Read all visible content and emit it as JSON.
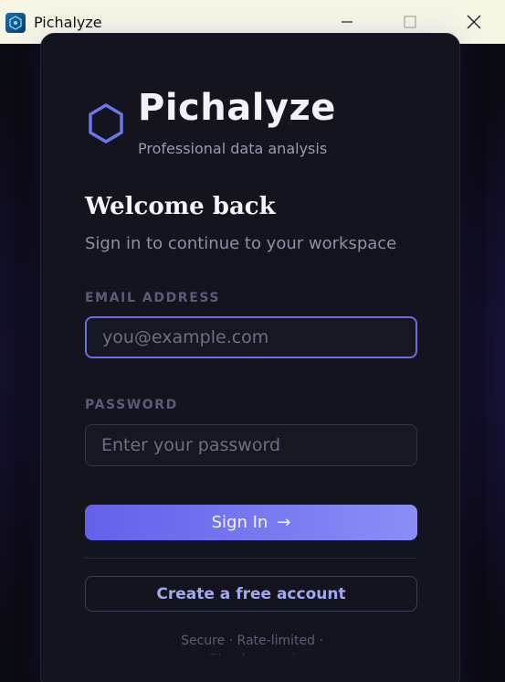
{
  "window": {
    "title": "Pichalyze"
  },
  "brand": {
    "name": "Pichalyze",
    "tagline": "Professional data analysis",
    "accent": "#6a6ee0"
  },
  "form": {
    "heading": "Welcome back",
    "subheading": "Sign in to continue to your workspace",
    "email_label": "EMAIL ADDRESS",
    "email_placeholder": "you@example.com",
    "email_value": "",
    "password_label": "PASSWORD",
    "password_placeholder": "Enter your password",
    "password_value": "",
    "signin_label": "Sign In",
    "signin_arrow": "→",
    "create_label": "Create a free account"
  },
  "footer": {
    "text": "Secure · Rate-limited · Cloud-synced"
  },
  "icons": {
    "app": "app-logo-icon",
    "brand": "hexagon-icon",
    "minimize": "minimize-icon",
    "maximize": "maximize-icon",
    "close": "close-icon"
  }
}
